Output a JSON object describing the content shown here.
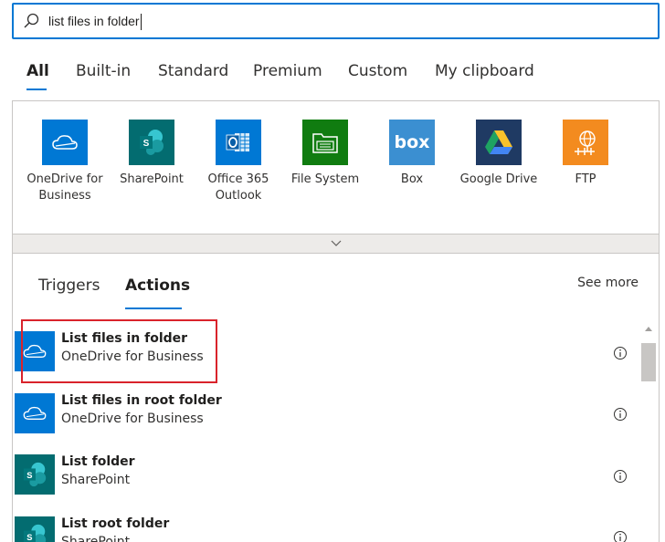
{
  "search": {
    "value": "list files in folder"
  },
  "category_tabs": [
    "All",
    "Built-in",
    "Standard",
    "Premium",
    "Custom",
    "My clipboard"
  ],
  "connectors": [
    {
      "name": "OneDrive for Business",
      "icon": "onedrive-icon",
      "color": "#0078d4"
    },
    {
      "name": "SharePoint",
      "icon": "sharepoint-icon",
      "color": "#036c70"
    },
    {
      "name": "Office 365 Outlook",
      "icon": "outlook-icon",
      "color": "#0078d4"
    },
    {
      "name": "File System",
      "icon": "file-system-icon",
      "color": "#107c10"
    },
    {
      "name": "Box",
      "icon": "box-icon",
      "color": "#3b8fd1"
    },
    {
      "name": "Google Drive",
      "icon": "google-drive-icon",
      "color": "#1f3a63"
    },
    {
      "name": "FTP",
      "icon": "ftp-icon",
      "color": "#f38b1f"
    }
  ],
  "result_tabs": {
    "triggers": "Triggers",
    "actions": "Actions",
    "see_more": "See more"
  },
  "actions": [
    {
      "title": "List files in folder",
      "subtitle": "OneDrive for Business",
      "icon": "onedrive-icon",
      "color": "#0078d4",
      "highlighted": true
    },
    {
      "title": "List files in root folder",
      "subtitle": "OneDrive for Business",
      "icon": "onedrive-icon",
      "color": "#0078d4"
    },
    {
      "title": "List folder",
      "subtitle": "SharePoint",
      "icon": "sharepoint-icon",
      "color": "#036c70"
    },
    {
      "title": "List root folder",
      "subtitle": "SharePoint",
      "icon": "sharepoint-icon",
      "color": "#036c70"
    }
  ],
  "colors": {
    "accent": "#0078d4",
    "highlight": "#d9232b"
  }
}
